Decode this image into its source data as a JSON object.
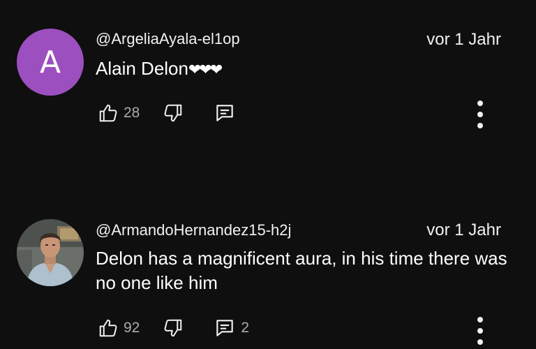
{
  "comments": [
    {
      "avatar_letter": "A",
      "author": "@ArgeliaAyala-el1op",
      "timestamp": "vor 1 Jahr",
      "text": "Alain Delon",
      "text_suffix": "❤❤❤",
      "likes": "28",
      "replies": ""
    },
    {
      "author": "@ArmandoHernandez15-h2j",
      "timestamp": "vor 1 Jahr",
      "text": "Delon has a magnificent aura, in his time there was no one like him",
      "likes": "92",
      "replies": "2"
    }
  ],
  "colors": {
    "background": "#0f0f0f",
    "avatar_purple": "#9c4fbf",
    "secondary_text": "#aaaaaa"
  },
  "icons": [
    "thumbs-up-icon",
    "thumbs-down-icon",
    "comment-icon",
    "more-vert-icon"
  ]
}
